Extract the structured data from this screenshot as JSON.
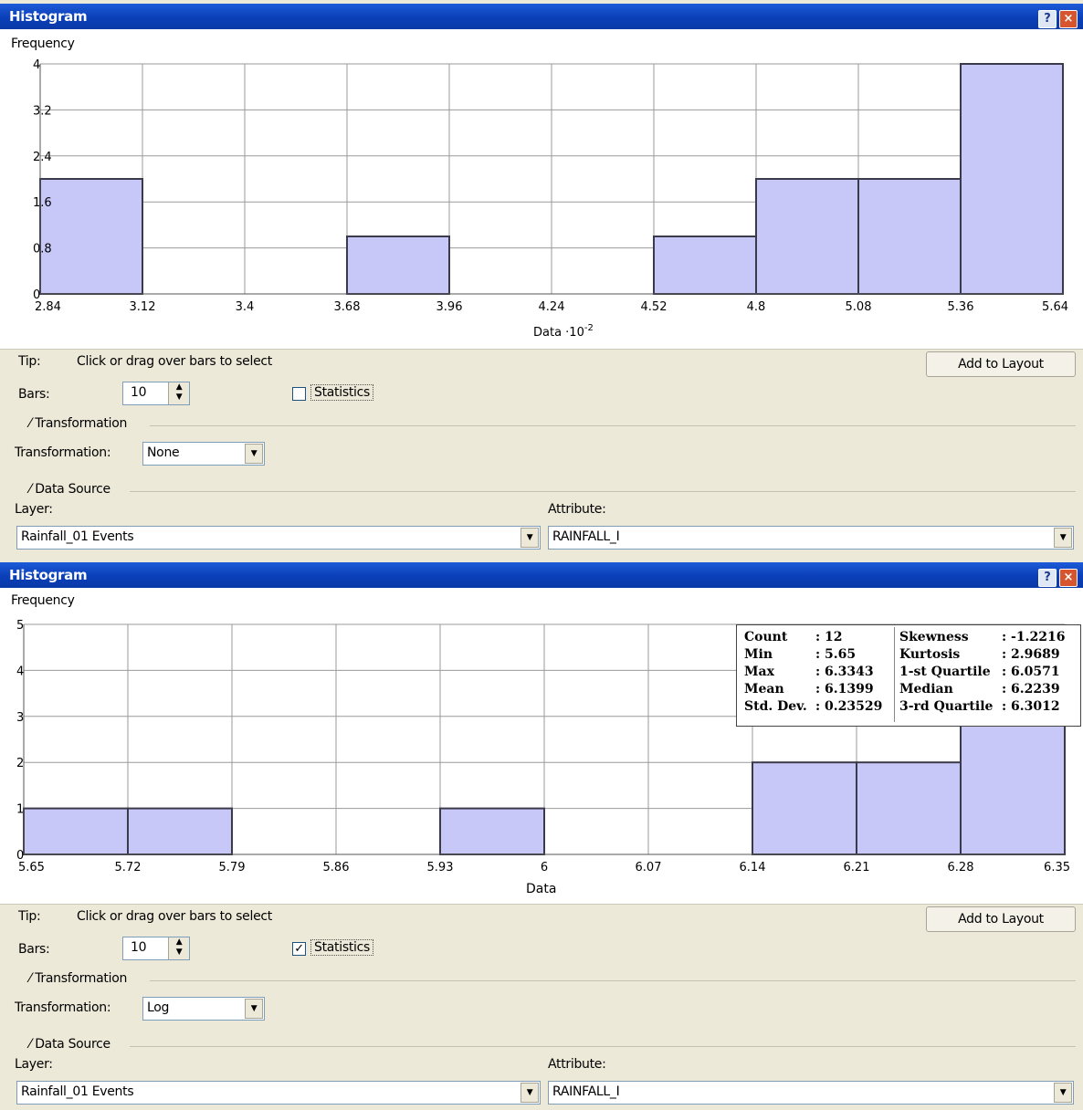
{
  "windows": [
    {
      "title": "Histogram",
      "help_glyph": "?",
      "close_glyph": "×",
      "frequency_label": "Frequency",
      "x_axis_label_base": "Data ·10",
      "x_axis_label_exp": "-2",
      "tip_label": "Tip:",
      "tip_text": "Click or drag over bars to select",
      "add_to_layout": "Add to Layout",
      "bars_label": "Bars:",
      "bars_value": "10",
      "statistics_label": "Statistics",
      "statistics_checked": false,
      "transformation_group": "Transformation",
      "transformation_label": "Transformation:",
      "transformation_value": "None",
      "data_source_group": "Data Source",
      "layer_label": "Layer:",
      "layer_value": "Rainfall_01 Events",
      "attribute_label": "Attribute:",
      "attribute_value": "RAINFALL_I"
    },
    {
      "title": "Histogram",
      "help_glyph": "?",
      "close_glyph": "×",
      "frequency_label": "Frequency",
      "x_axis_label": "Data",
      "tip_label": "Tip:",
      "tip_text": "Click or drag over bars to select",
      "add_to_layout": "Add to Layout",
      "bars_label": "Bars:",
      "bars_value": "10",
      "statistics_label": "Statistics",
      "statistics_checked": true,
      "transformation_group": "Transformation",
      "transformation_label": "Transformation:",
      "transformation_value": "Log",
      "data_source_group": "Data Source",
      "layer_label": "Layer:",
      "layer_value": "Rainfall_01 Events",
      "attribute_label": "Attribute:",
      "attribute_value": "RAINFALL_I",
      "stats": {
        "left": [
          [
            "Count",
            ": 12"
          ],
          [
            "Min",
            ": 5.65"
          ],
          [
            "Max",
            ": 6.3343"
          ],
          [
            "Mean",
            ": 6.1399"
          ],
          [
            "Std. Dev.",
            ": 0.23529"
          ]
        ],
        "right": [
          [
            "Skewness",
            ": -1.2216"
          ],
          [
            "Kurtosis",
            ": 2.9689"
          ],
          [
            "1-st Quartile",
            ": 6.0571"
          ],
          [
            "Median",
            ": 6.2239"
          ],
          [
            "3-rd Quartile",
            ": 6.3012"
          ]
        ]
      }
    }
  ],
  "chart_data": [
    {
      "type": "bar",
      "title": "",
      "xlabel": "Data ·10^-2",
      "ylabel": "Frequency",
      "x_ticks": [
        "2.84",
        "3.12",
        "3.4",
        "3.68",
        "3.96",
        "4.24",
        "4.52",
        "4.8",
        "5.08",
        "5.36",
        "5.64"
      ],
      "y_ticks": [
        "0",
        "0.8",
        "1.6",
        "2.4",
        "3.2",
        "4"
      ],
      "ylim": [
        0,
        4
      ],
      "bins": [
        {
          "from": 2.84,
          "to": 3.12,
          "count": 2
        },
        {
          "from": 3.12,
          "to": 3.4,
          "count": 0
        },
        {
          "from": 3.4,
          "to": 3.68,
          "count": 0
        },
        {
          "from": 3.68,
          "to": 3.96,
          "count": 1
        },
        {
          "from": 3.96,
          "to": 4.24,
          "count": 0
        },
        {
          "from": 4.24,
          "to": 4.52,
          "count": 0
        },
        {
          "from": 4.52,
          "to": 4.8,
          "count": 1
        },
        {
          "from": 4.8,
          "to": 5.08,
          "count": 2
        },
        {
          "from": 5.08,
          "to": 5.36,
          "count": 2
        },
        {
          "from": 5.36,
          "to": 5.64,
          "count": 4
        }
      ],
      "bar_color": "#c8c8f8",
      "grid": true
    },
    {
      "type": "bar",
      "title": "",
      "xlabel": "Data",
      "ylabel": "Frequency",
      "x_ticks": [
        "5.65",
        "5.72",
        "5.79",
        "5.86",
        "5.93",
        "6",
        "6.07",
        "6.14",
        "6.21",
        "6.28",
        "6.35"
      ],
      "y_ticks": [
        "0",
        "1",
        "2",
        "3",
        "4",
        "5"
      ],
      "ylim": [
        0,
        5
      ],
      "bins": [
        {
          "from": 5.65,
          "to": 5.72,
          "count": 1
        },
        {
          "from": 5.72,
          "to": 5.79,
          "count": 1
        },
        {
          "from": 5.79,
          "to": 5.86,
          "count": 0
        },
        {
          "from": 5.86,
          "to": 5.93,
          "count": 0
        },
        {
          "from": 5.93,
          "to": 6.0,
          "count": 1
        },
        {
          "from": 6.0,
          "to": 6.07,
          "count": 0
        },
        {
          "from": 6.07,
          "to": 6.14,
          "count": 0
        },
        {
          "from": 6.14,
          "to": 6.21,
          "count": 2
        },
        {
          "from": 6.21,
          "to": 6.28,
          "count": 2
        },
        {
          "from": 6.28,
          "to": 6.35,
          "count": 4
        }
      ],
      "bar_color": "#c8c8f8",
      "grid": true
    }
  ]
}
